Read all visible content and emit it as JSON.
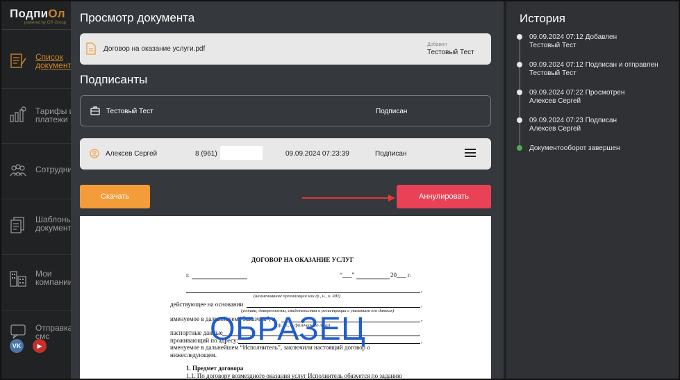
{
  "sidebar": {
    "logo_main": "Подпи",
    "logo_accent": "Ол",
    "logo_sub": "powered by GR Group",
    "items": [
      {
        "label": "Список\nдокумент",
        "icon": "document-list-icon",
        "active": true
      },
      {
        "label": "Тарифы и\nплатежи",
        "icon": "tariff-icon",
        "active": false
      },
      {
        "label": "Сотрудни",
        "icon": "employees-icon",
        "active": false
      },
      {
        "label": "Шаблоны\nдокумент",
        "icon": "templates-icon",
        "active": false
      },
      {
        "label": "Мои\nкомпании",
        "icon": "companies-icon",
        "active": false
      },
      {
        "label": "Отправка\nсмс",
        "icon": "sms-icon",
        "active": false
      }
    ],
    "social": [
      {
        "icon": "vk-icon",
        "text": "VK",
        "color": "#4a76a8"
      },
      {
        "icon": "youtube-icon",
        "text": "▶",
        "color": "#c4302b"
      }
    ]
  },
  "document_view": {
    "title": "Просмотр документа",
    "file_name": "Договор на оказание услуги.pdf",
    "added_label": "Добавил",
    "added_by": "Тестовый Тест"
  },
  "signers": {
    "title": "Подписанты",
    "rows": [
      {
        "name": "Тестовый Тест",
        "phone": "",
        "date": "",
        "status": "Подписан"
      },
      {
        "name": "Алексев Сергей",
        "phone": "8 (961)",
        "date": "09.09.2024 07:23:39",
        "status": "Подписан"
      }
    ]
  },
  "actions": {
    "download": "Скачать",
    "annul": "Аннулировать"
  },
  "preview": {
    "heading": "ДОГОВОР НА ОКАЗАНИЕ УСЛУГ",
    "city_prefix": "г.",
    "date_q1": "“___”",
    "date_year": "20___ г.",
    "note_org": "(наименование организации или ф., и., о. ИП)",
    "acting_basis": "действующее на основании",
    "note_basis": "(устава, доверенности, свидетельства о регистрации с указанием его данных)",
    "customer": "именуемое в дальнейшем “Заказчик”, и",
    "note_fio": "(ф., и., о. физического лица)",
    "passport": "паспортные данные",
    "address": "проживающий по адресу:",
    "executor": "именуемое    в    дальнейшем    “Исполнитель”,    заключили    настоящий    договор    о",
    "executor2": "нижеследующем.",
    "section1": "1. Предмет договора",
    "clause11": "1.1.  По  договору  возмездного  оказания  услуг  Исполнитель  обязуется  по  заданию",
    "watermark": "ОБРАЗЕЦ"
  },
  "history": {
    "title": "История",
    "events": [
      {
        "line1": "09.09.2024 07:12 Добавлен",
        "line2": "Тестовый Тест",
        "done": false
      },
      {
        "line1": "09.09.2024 07:12 Подписан и отправлен",
        "line2": "Тестовый Тест",
        "done": false
      },
      {
        "line1": "09.09.2024 07:22 Просмотрен",
        "line2": "Алексев Сергей",
        "done": false
      },
      {
        "line1": "09.09.2024 07:23 Подписан",
        "line2": "Алексев Сергей",
        "done": false
      },
      {
        "line1": "Документооборот завершен",
        "line2": "",
        "done": true
      }
    ]
  },
  "colors": {
    "accent": "#c98528",
    "download": "#f39c3a",
    "annul": "#e94256",
    "watermark": "#1656c9",
    "complete": "#4caf50"
  }
}
